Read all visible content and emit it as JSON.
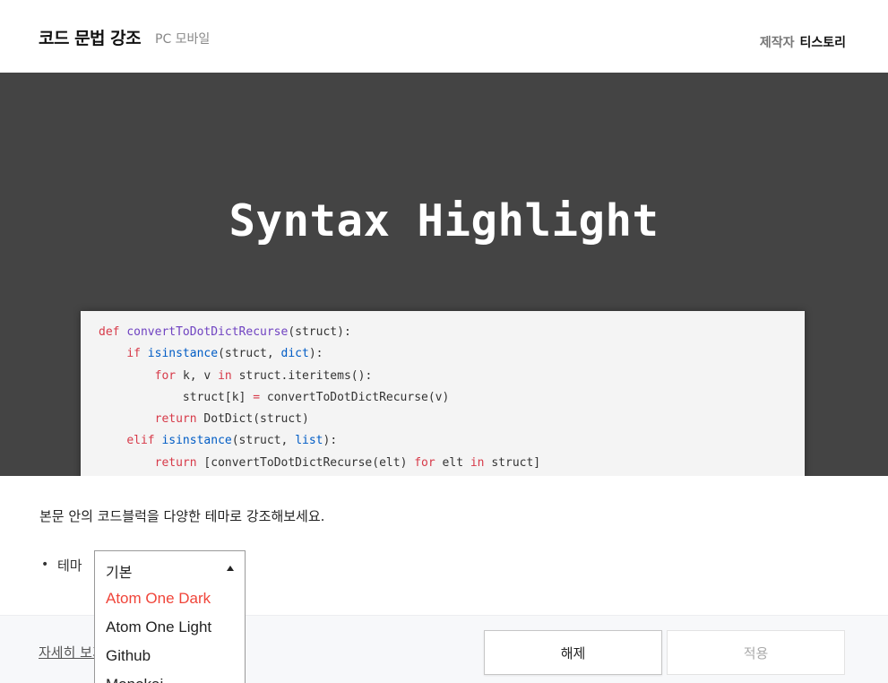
{
  "header": {
    "title": "코드 문법 강조",
    "platform": "PC 모바일",
    "author_label": "제작자",
    "author_name": "티스토리"
  },
  "hero": {
    "title": "Syntax Highlight",
    "code_lines": [
      [
        {
          "t": "def ",
          "c": "kw"
        },
        {
          "t": "convertToDotDictRecurse",
          "c": "fn"
        },
        {
          "t": "(struct):",
          "c": ""
        }
      ],
      [
        {
          "t": "    ",
          "c": ""
        },
        {
          "t": "if ",
          "c": "kw"
        },
        {
          "t": "isinstance",
          "c": "bi"
        },
        {
          "t": "(struct, ",
          "c": ""
        },
        {
          "t": "dict",
          "c": "bi"
        },
        {
          "t": "):",
          "c": ""
        }
      ],
      [
        {
          "t": "        ",
          "c": ""
        },
        {
          "t": "for ",
          "c": "kw"
        },
        {
          "t": "k, v ",
          "c": ""
        },
        {
          "t": "in ",
          "c": "kw"
        },
        {
          "t": "struct.iteritems():",
          "c": ""
        }
      ],
      [
        {
          "t": "            struct[k] ",
          "c": ""
        },
        {
          "t": "= ",
          "c": "kw"
        },
        {
          "t": "convertToDotDictRecurse(v)",
          "c": ""
        }
      ],
      [
        {
          "t": "        ",
          "c": ""
        },
        {
          "t": "return ",
          "c": "kw"
        },
        {
          "t": "DotDict(struct)",
          "c": ""
        }
      ],
      [
        {
          "t": "    ",
          "c": ""
        },
        {
          "t": "elif ",
          "c": "kw"
        },
        {
          "t": "isinstance",
          "c": "bi"
        },
        {
          "t": "(struct, ",
          "c": ""
        },
        {
          "t": "list",
          "c": "bi"
        },
        {
          "t": "):",
          "c": ""
        }
      ],
      [
        {
          "t": "        ",
          "c": ""
        },
        {
          "t": "return ",
          "c": "kw"
        },
        {
          "t": "[convertToDotDictRecurse(elt) ",
          "c": ""
        },
        {
          "t": "for ",
          "c": "kw"
        },
        {
          "t": "elt ",
          "c": ""
        },
        {
          "t": "in ",
          "c": "kw"
        },
        {
          "t": "struct]",
          "c": ""
        }
      ]
    ]
  },
  "body": {
    "description": "본문 안의 코드블럭을 다양한 테마로 강조해보세요.",
    "bullet": "•",
    "theme_label": "테마"
  },
  "theme_select": {
    "current": "기본",
    "options": [
      "Atom One Dark",
      "Atom One Light",
      "Github",
      "Monokai"
    ],
    "highlighted_index": 0
  },
  "footer": {
    "detail_link": "자세히 보기",
    "release_label": "해제",
    "apply_label": "적용"
  },
  "colors": {
    "hero_bg": "#444444",
    "keyword": "#d73a49",
    "function": "#6f42c1",
    "builtin": "#005cc5",
    "highlight_option": "#f0453a"
  }
}
